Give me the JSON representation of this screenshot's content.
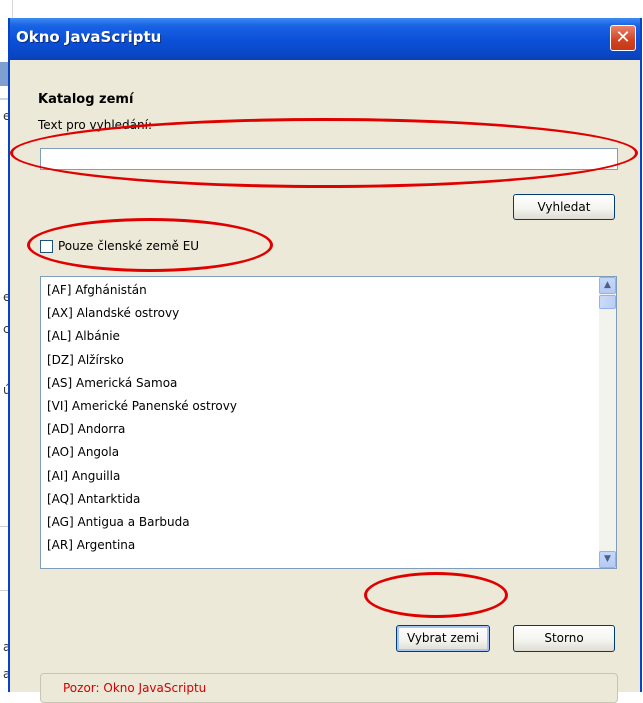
{
  "window": {
    "title": "Okno JavaScriptu",
    "close_glyph": "✕"
  },
  "dialog": {
    "heading": "Katalog zemí",
    "search_label": "Text pro vyhledání:",
    "search_value": "",
    "search_button": "Vyhledat",
    "eu_only_label": "Pouze členské země EU",
    "eu_only_checked": false
  },
  "countries": [
    "[AF] Afghánistán",
    "[AX] Alandské ostrovy",
    "[AL] Albánie",
    "[DZ] Alžírsko",
    "[AS] Americká Samoa",
    "[VI] Americké Panenské ostrovy",
    "[AD] Andorra",
    "[AO] Angola",
    "[AI] Anguilla",
    "[AQ] Antarktida",
    "[AG] Antigua a Barbuda",
    "[AR] Argentina"
  ],
  "buttons": {
    "select": "Vybrat zemi",
    "cancel": "Storno"
  },
  "status": "Pozor: Okno JavaScriptu",
  "background_page": {
    "letters": [
      "el",
      "e",
      "c",
      "ú",
      "a",
      "a"
    ]
  },
  "colors": {
    "titlebar": "#0b4fd8",
    "annotation": "#e00000",
    "status_text": "#d40000",
    "dialog_bg": "#ece9d8"
  }
}
